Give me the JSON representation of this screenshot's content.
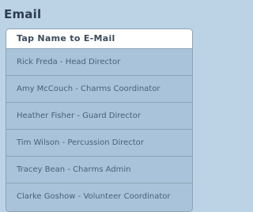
{
  "section": {
    "title": "Email"
  },
  "list": {
    "header": "Tap Name to E-Mail",
    "items": [
      {
        "label": "Rick Freda  - Head Director"
      },
      {
        "label": "Amy McCouch  - Charms Coordinator"
      },
      {
        "label": "Heather Fisher  - Guard Director"
      },
      {
        "label": "Tim Wilson  - Percussion Director"
      },
      {
        "label": "Tracey Bean  - Charms Admin"
      },
      {
        "label": "Clarke Goshow  - Volunteer Coordinator"
      }
    ]
  },
  "colors": {
    "background": "#bcd3e5",
    "list_background": "#a9c4da",
    "header_background": "#ffffff",
    "border": "#8da3b6",
    "title_text": "#2c3e50",
    "item_text": "#4a6178"
  }
}
